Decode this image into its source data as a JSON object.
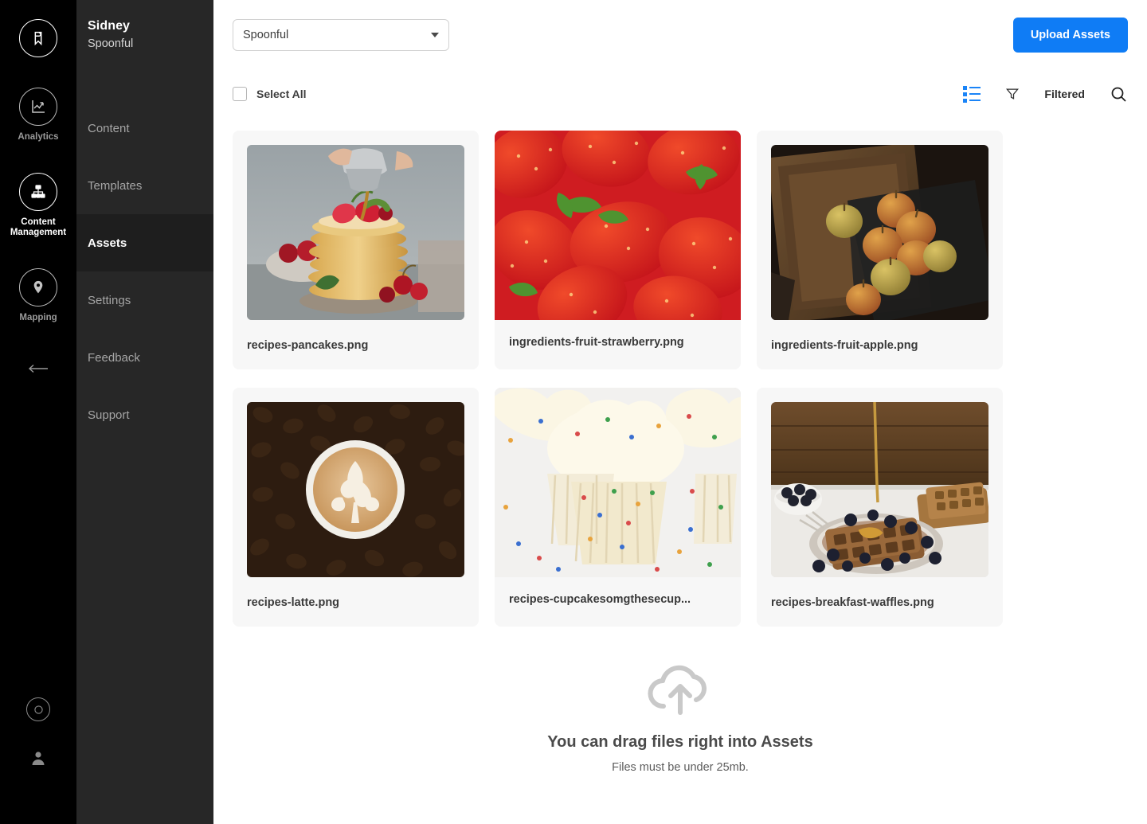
{
  "rail": {
    "logo_icon": "bookmark-circle-logo",
    "items": [
      {
        "id": "analytics",
        "label": "Analytics",
        "icon": "analytics-chart-icon",
        "active": false
      },
      {
        "id": "content-management",
        "label": "Content Management",
        "icon": "sitemap-icon",
        "active": true
      },
      {
        "id": "mapping",
        "label": "Mapping",
        "icon": "map-pin-icon",
        "active": false
      }
    ],
    "collapse_icon": "arrow-left-icon",
    "bottom": [
      {
        "id": "help",
        "icon": "lifebuoy-icon"
      },
      {
        "id": "account",
        "icon": "person-icon"
      }
    ]
  },
  "nav": {
    "org_name": "Sidney",
    "org_sub": "Spoonful",
    "items": [
      {
        "id": "content",
        "label": "Content",
        "active": false
      },
      {
        "id": "templates",
        "label": "Templates",
        "active": false
      },
      {
        "id": "assets",
        "label": "Assets",
        "active": true
      },
      {
        "id": "settings",
        "label": "Settings",
        "active": false
      },
      {
        "id": "feedback",
        "label": "Feedback",
        "active": false
      },
      {
        "id": "support",
        "label": "Support",
        "active": false
      }
    ]
  },
  "topbar": {
    "site_select_value": "Spoonful",
    "upload_button_label": "Upload Assets",
    "accent_color": "#0f7cf5"
  },
  "actionbar": {
    "select_all_label": "Select All",
    "select_all_checked": false,
    "view_toggle_icon": "list-view-icon",
    "filter_icon": "funnel-icon",
    "filtered_label": "Filtered",
    "search_icon": "search-icon"
  },
  "assets": [
    {
      "name": "recipes-pancakes.png",
      "image": "pancakes",
      "flush": false
    },
    {
      "name": "ingredients-fruit-strawberry.png",
      "image": "strawberry",
      "flush": true
    },
    {
      "name": "ingredients-fruit-apple.png",
      "image": "apple",
      "flush": false
    },
    {
      "name": "recipes-latte.png",
      "image": "latte",
      "flush": false
    },
    {
      "name": "recipes-cupcakesomgthesecup...",
      "image": "cupcake",
      "flush": true
    },
    {
      "name": "recipes-breakfast-waffles.png",
      "image": "waffles",
      "flush": false
    }
  ],
  "dropzone": {
    "icon": "cloud-upload-icon",
    "title": "You can drag files right into Assets",
    "subtitle": "Files must be under 25mb."
  }
}
